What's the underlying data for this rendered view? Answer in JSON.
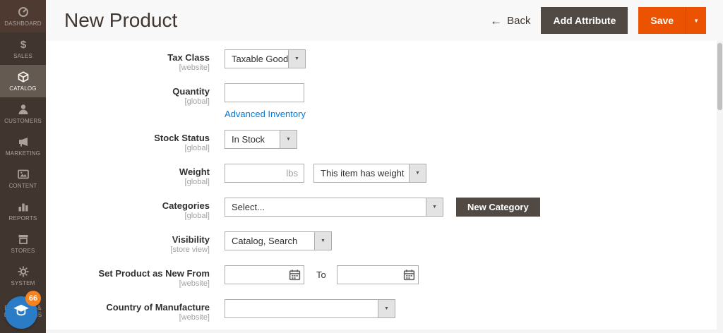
{
  "colors": {
    "accent_orange": "#eb5202",
    "dark_button": "#514943",
    "link_blue": "#007bdb",
    "sidebar_bg": "#41362f",
    "sidebar_active_bg": "#645a51",
    "badge_orange": "#f5821f",
    "assist_blue": "#2a7cc7"
  },
  "sidebar": {
    "notification_badge": "66",
    "items": [
      {
        "label": "DASHBOARD",
        "icon": "dashboard-icon"
      },
      {
        "label": "SALES",
        "icon": "sales-icon"
      },
      {
        "label": "CATALOG",
        "icon": "catalog-icon",
        "active": true
      },
      {
        "label": "CUSTOMERS",
        "icon": "customers-icon"
      },
      {
        "label": "MARKETING",
        "icon": "marketing-icon"
      },
      {
        "label": "CONTENT",
        "icon": "content-icon"
      },
      {
        "label": "REPORTS",
        "icon": "reports-icon"
      },
      {
        "label": "STORES",
        "icon": "stores-icon"
      },
      {
        "label": "SYSTEM",
        "icon": "system-icon"
      },
      {
        "label": "FIND PARTNERS & EXTENSIONS",
        "icon": "extensions-icon"
      }
    ]
  },
  "header": {
    "title": "New Product",
    "back_label": "Back",
    "add_attribute_label": "Add Attribute",
    "save_label": "Save"
  },
  "form": {
    "tax_class": {
      "label": "Tax Class",
      "scope": "[website]",
      "value": "Taxable Goods"
    },
    "quantity": {
      "label": "Quantity",
      "scope": "[global]",
      "value": "",
      "link_label": "Advanced Inventory"
    },
    "stock_status": {
      "label": "Stock Status",
      "scope": "[global]",
      "value": "In Stock"
    },
    "weight": {
      "label": "Weight",
      "scope": "[global]",
      "value": "",
      "unit": "lbs",
      "select_value": "This item has weight"
    },
    "categories": {
      "label": "Categories",
      "scope": "[global]",
      "value": "Select...",
      "button_label": "New Category"
    },
    "visibility": {
      "label": "Visibility",
      "scope": "[store view]",
      "value": "Catalog, Search"
    },
    "new_from": {
      "label": "Set Product as New From",
      "scope": "[website]",
      "from_value": "",
      "to_label": "To",
      "to_value": ""
    },
    "country": {
      "label": "Country of Manufacture",
      "scope": "[website]",
      "value": ""
    }
  }
}
